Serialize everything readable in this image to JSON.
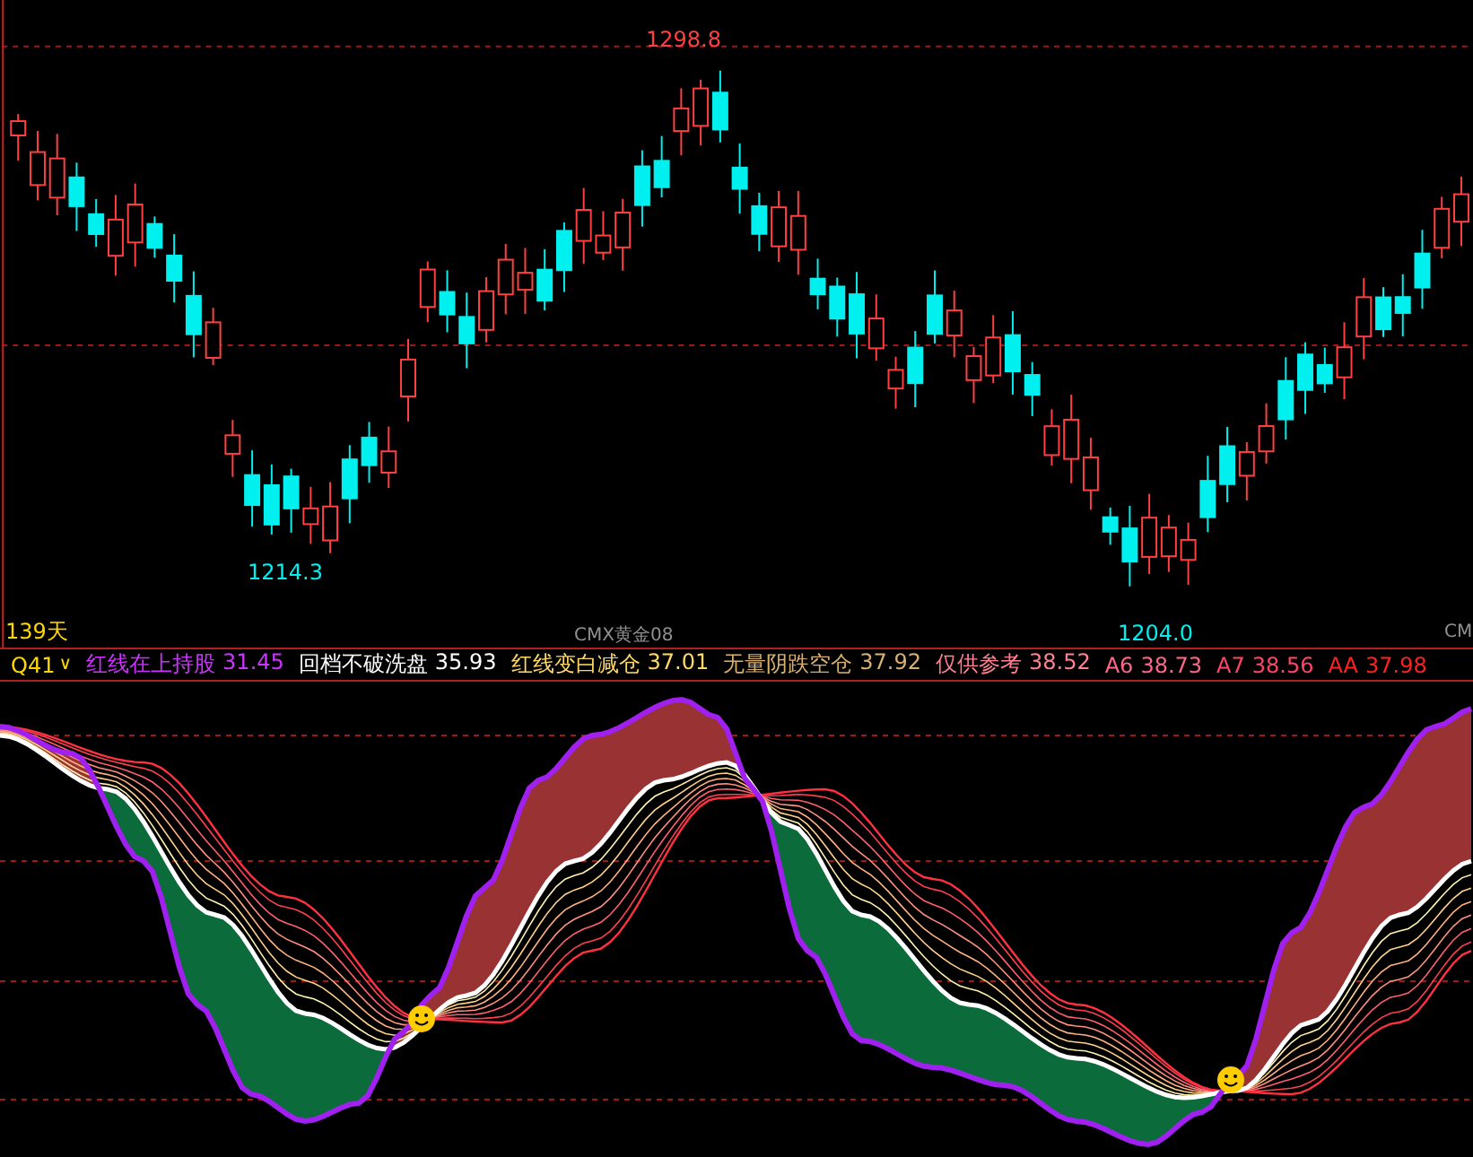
{
  "price_panel": {
    "high_label": "1298.8",
    "low_labels": [
      {
        "text": "1214.3"
      },
      {
        "text": "1204.0"
      }
    ],
    "period": "139天",
    "symbol": "CMX黄金08",
    "edge_symbol": "CM"
  },
  "indicator_panel": {
    "name": "Q41",
    "dropdown": "∨",
    "legend": [
      {
        "label": "红线在上持股",
        "value": "31.45"
      },
      {
        "label": "回档不破洗盘",
        "value": "35.93"
      },
      {
        "label": "红线变白减仓",
        "value": "37.01"
      },
      {
        "label": "无量阴跌空仓",
        "value": "37.92"
      },
      {
        "label": "仅供参考",
        "value": "38.52"
      },
      {
        "label": "A6",
        "value": "38.73"
      },
      {
        "label": "A7",
        "value": "38.56"
      },
      {
        "label": "AA",
        "value": "37.98"
      }
    ]
  }
}
